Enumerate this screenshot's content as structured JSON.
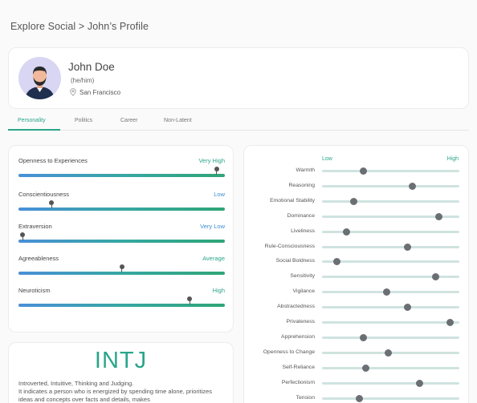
{
  "breadcrumb": "Explore Social > John’s Profile",
  "profile": {
    "name": "John Doe",
    "pronouns": "(he/him)",
    "location": "San Francisco"
  },
  "tabs": [
    {
      "label": "Personality",
      "active": true
    },
    {
      "label": "Politics",
      "active": false
    },
    {
      "label": "Career",
      "active": false
    },
    {
      "label": "Non-Latent",
      "active": false
    }
  ],
  "traits": [
    {
      "name": "Openness to Experiences",
      "level": "Very High",
      "level_color": "green",
      "value": 0.96
    },
    {
      "name": "Conscientiousness",
      "level": "Low",
      "level_color": "blue",
      "value": 0.16
    },
    {
      "name": "Extraversion",
      "level": "Very Low",
      "level_color": "blue",
      "value": 0.02
    },
    {
      "name": "Agreeableness",
      "level": "Average",
      "level_color": "green",
      "value": 0.5
    },
    {
      "name": "Neuroticism",
      "level": "High",
      "level_color": "green",
      "value": 0.83
    }
  ],
  "type": {
    "code": "INTJ",
    "description_1": "Introverted, Intuitive, Thinking and Judging.",
    "description_2": "It indicates a person who is energized by spending time alone, prioritizes ideas and concepts over facts and details, makes"
  },
  "factors_scale": {
    "low": "Low",
    "high": "High"
  },
  "factors": [
    {
      "name": "Warmth",
      "value": 0.3
    },
    {
      "name": "Reasoning",
      "value": 0.66
    },
    {
      "name": "Emotional Stability",
      "value": 0.23
    },
    {
      "name": "Dominance",
      "value": 0.85
    },
    {
      "name": "Liveliness",
      "value": 0.18
    },
    {
      "name": "Rule-Consciousness",
      "value": 0.62
    },
    {
      "name": "Social Boldness",
      "value": 0.11
    },
    {
      "name": "Sensitivity",
      "value": 0.83
    },
    {
      "name": "Vigilance",
      "value": 0.47
    },
    {
      "name": "Abstractedness",
      "value": 0.62
    },
    {
      "name": "Privateness",
      "value": 0.93
    },
    {
      "name": "Apprehension",
      "value": 0.3
    },
    {
      "name": "Openness to Change",
      "value": 0.48
    },
    {
      "name": "Self-Reliance",
      "value": 0.32
    },
    {
      "name": "Perfectionism",
      "value": 0.71
    },
    {
      "name": "Tension",
      "value": 0.27
    }
  ],
  "colors": {
    "accent": "#2aa58a",
    "blue": "#3d8bd0",
    "track": "#cfe3df",
    "avatar_bg": "#d9d6f3"
  },
  "icons": {
    "location": "pin-icon"
  }
}
